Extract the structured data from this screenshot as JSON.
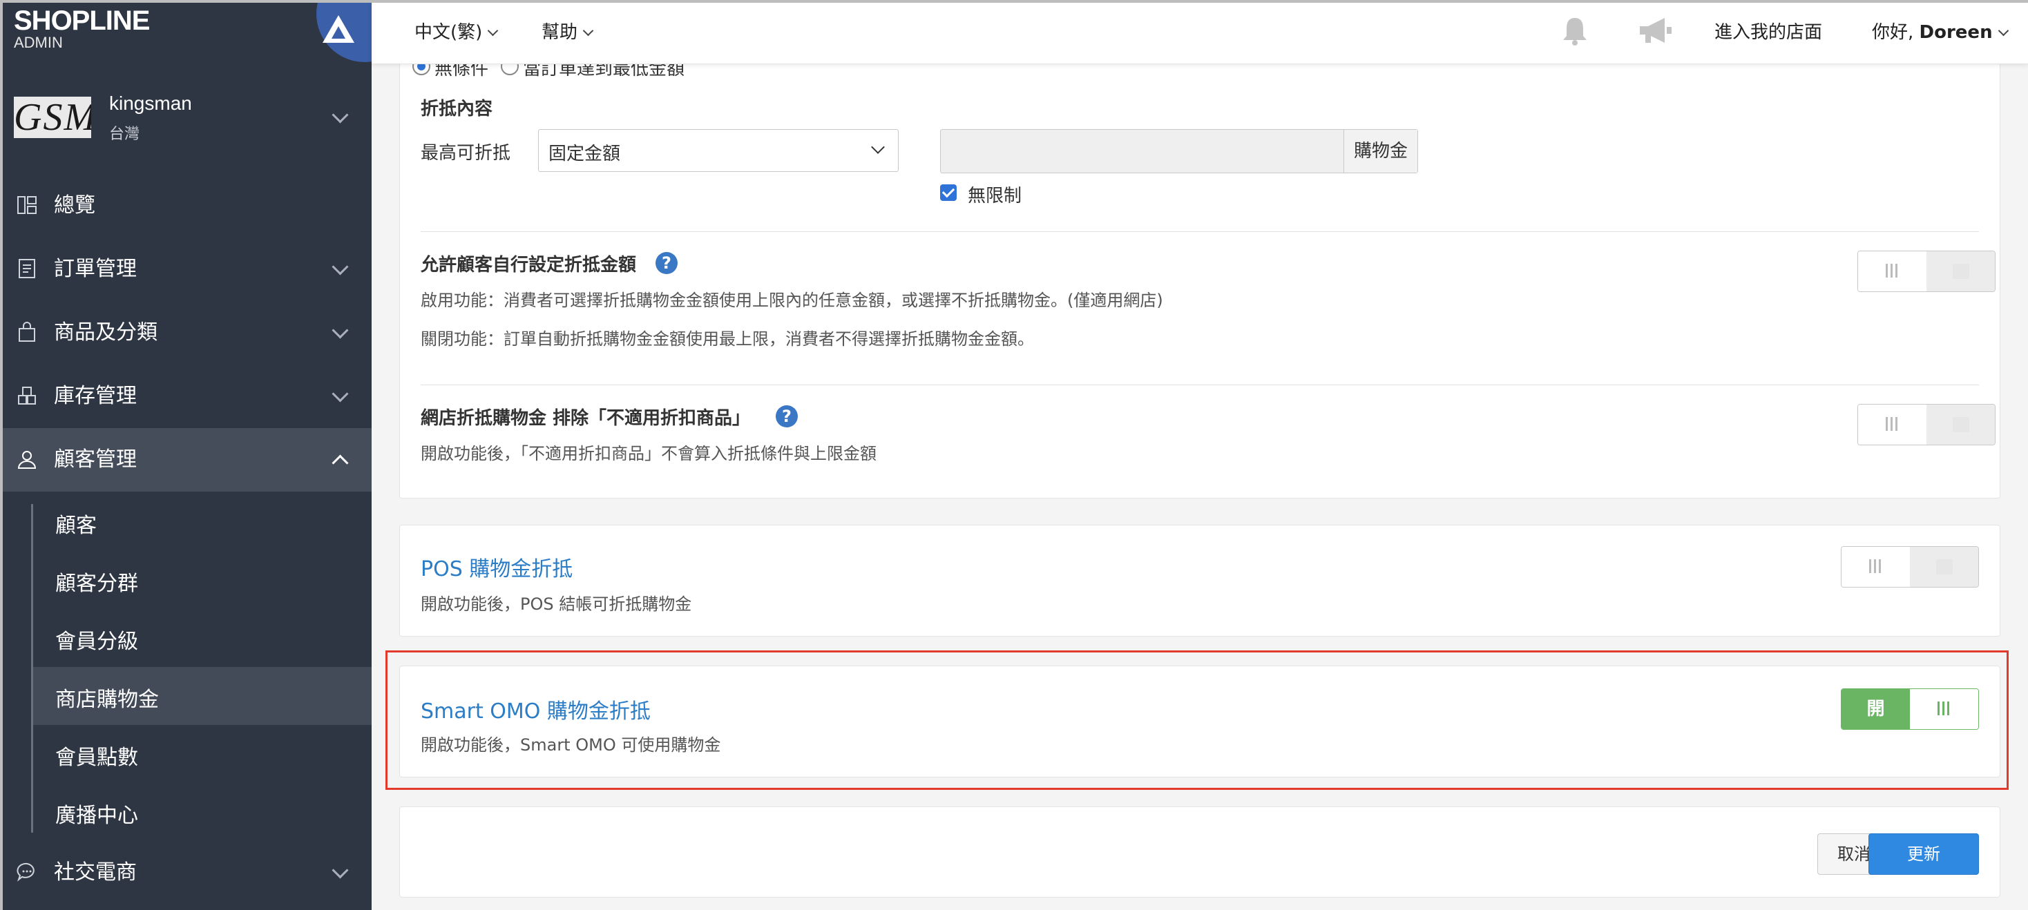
{
  "brand": {
    "name": "SHOPLINE",
    "sub": "ADMIN"
  },
  "store": {
    "logo_text": "GSM",
    "name": "kingsman",
    "region": "台灣"
  },
  "nav": [
    {
      "label": "總覽",
      "icon": "dashboard-icon"
    },
    {
      "label": "訂單管理",
      "icon": "order-icon"
    },
    {
      "label": "商品及分類",
      "icon": "shopping-bag-icon"
    },
    {
      "label": "庫存管理",
      "icon": "inventory-icon"
    },
    {
      "label": "顧客管理",
      "icon": "user-icon"
    },
    {
      "label": "社交電商",
      "icon": "chat-icon"
    }
  ],
  "subnav": [
    "顧客",
    "顧客分群",
    "會員分級",
    "商店購物金",
    "會員點數",
    "廣播中心"
  ],
  "topbar": {
    "language": "中文(繁)",
    "help": "幫助",
    "enter_store": "進入我的店面",
    "greeting": "你好, ",
    "user": "Doreen"
  },
  "form": {
    "radio_option1": "無條件",
    "radio_option2": "當訂單達到最低金額",
    "deduct_section_title": "折抵內容",
    "max_deduct_label": "最高可折抵",
    "max_deduct_select": "固定金額",
    "amount_addon": "購物金",
    "unlimited_label": "無限制",
    "custom_amount_title": "允許顧客自行設定折抵金額",
    "custom_amount_desc_on": "啟用功能：消費者可選擇折抵購物金金額使用上限內的任意金額，或選擇不折抵購物金。(僅適用網店)",
    "custom_amount_desc_off": "關閉功能：訂單自動折抵購物金金額使用最上限，消費者不得選擇折抵購物金金額。",
    "exclude_title": "網店折抵購物金 排除「不適用折扣商品」",
    "exclude_desc": "開啟功能後，「不適用折扣商品」不會算入折抵條件與上限金額",
    "pos_title": "POS 購物金折抵",
    "pos_desc": "開啟功能後，POS 結帳可折抵購物金",
    "omo_title": "Smart OMO 購物金折抵",
    "omo_desc": "開啟功能後，Smart OMO 可使用購物金",
    "toggle_on_label": "開",
    "cancel": "取消",
    "update": "更新"
  },
  "toggles": {
    "custom_amount": false,
    "exclude": false,
    "pos": false,
    "omo": true
  },
  "colors": {
    "sidebar": "#2f3643",
    "accent": "#2f89e0",
    "link": "#2b7dc7",
    "toggle_on": "#6ab564",
    "highlight": "#e23b2e"
  }
}
